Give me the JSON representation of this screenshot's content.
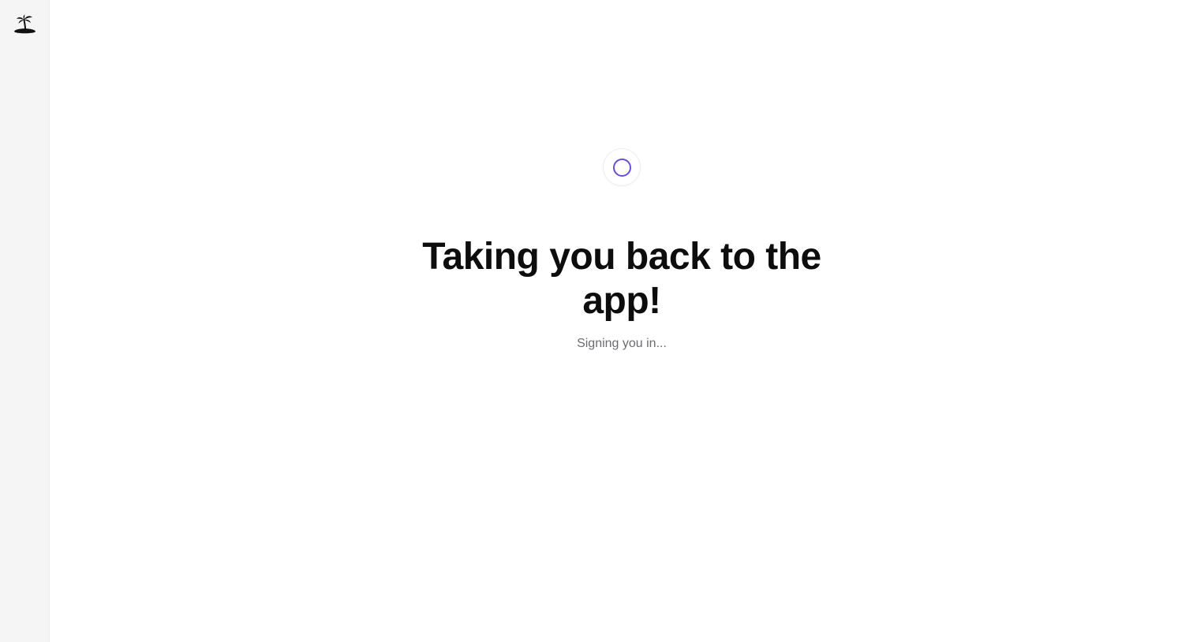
{
  "sidebar": {
    "logo_icon": "island-palm-icon"
  },
  "main": {
    "spinner_icon": "loading-spinner-icon",
    "spinner_color": "#6a4fd6",
    "title": "Taking you back to the app!",
    "subtitle": "Signing you in..."
  }
}
